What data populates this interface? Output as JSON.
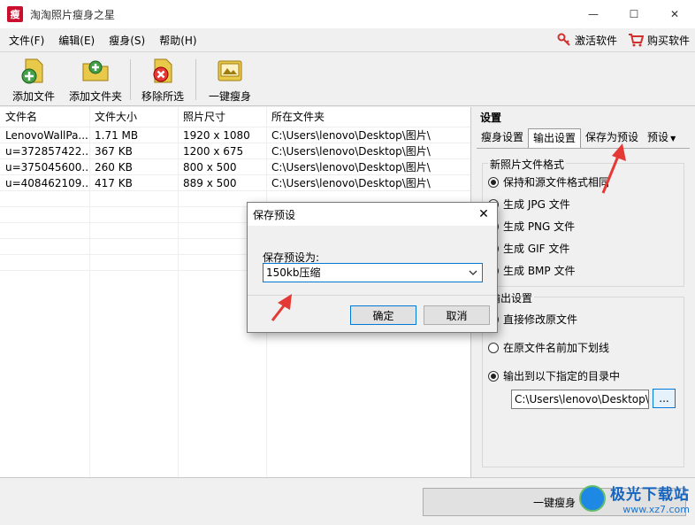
{
  "window": {
    "title": "淘淘照片瘦身之星",
    "app_icon_text": "瘦",
    "minimize": "—",
    "maximize": "☐",
    "close": "✕"
  },
  "menu": {
    "items": [
      "文件(F)",
      "编辑(E)",
      "瘦身(S)",
      "帮助(H)"
    ],
    "activate": "激活软件",
    "buy": "购买软件"
  },
  "toolbar": {
    "add_file": "添加文件",
    "add_folder": "添加文件夹",
    "remove_selected": "移除所选",
    "one_click_slim": "一键瘦身"
  },
  "file_list": {
    "headers": [
      "文件名",
      "文件大小",
      "照片尺寸",
      "所在文件夹"
    ],
    "rows": [
      [
        "LenovoWallPa...",
        "1.71 MB",
        "1920 x 1080",
        "C:\\Users\\lenovo\\Desktop\\图片\\"
      ],
      [
        "u=372857422...",
        "367 KB",
        "1200 x 675",
        "C:\\Users\\lenovo\\Desktop\\图片\\"
      ],
      [
        "u=375045600...",
        "260 KB",
        "800 x 500",
        "C:\\Users\\lenovo\\Desktop\\图片\\"
      ],
      [
        "u=408462109...",
        "417 KB",
        "889 x 500",
        "C:\\Users\\lenovo\\Desktop\\图片\\"
      ]
    ]
  },
  "settings": {
    "title": "设置",
    "tabs": [
      "瘦身设置",
      "输出设置",
      "保存为预设",
      "预设"
    ],
    "format_group": "新照片文件格式",
    "formats": [
      "保持和源文件格式相同",
      "生成 JPG 文件",
      "生成 PNG 文件",
      "生成 GIF 文件",
      "生成 BMP 文件"
    ],
    "output_group": "输出设置",
    "outputs": [
      "直接修改原文件",
      "在原文件名前加下划线",
      "输出到以下指定的目录中"
    ],
    "output_path": "C:\\Users\\lenovo\\Desktop\\o",
    "browse": "..."
  },
  "dialog": {
    "title": "保存预设",
    "close": "✕",
    "label": "保存预设为:",
    "value": "150kb压缩",
    "ok": "确定",
    "cancel": "取消"
  },
  "bottom": {
    "button": "一键瘦身"
  },
  "watermark": {
    "title": "极光下载站",
    "url": "www.xz7.com"
  }
}
